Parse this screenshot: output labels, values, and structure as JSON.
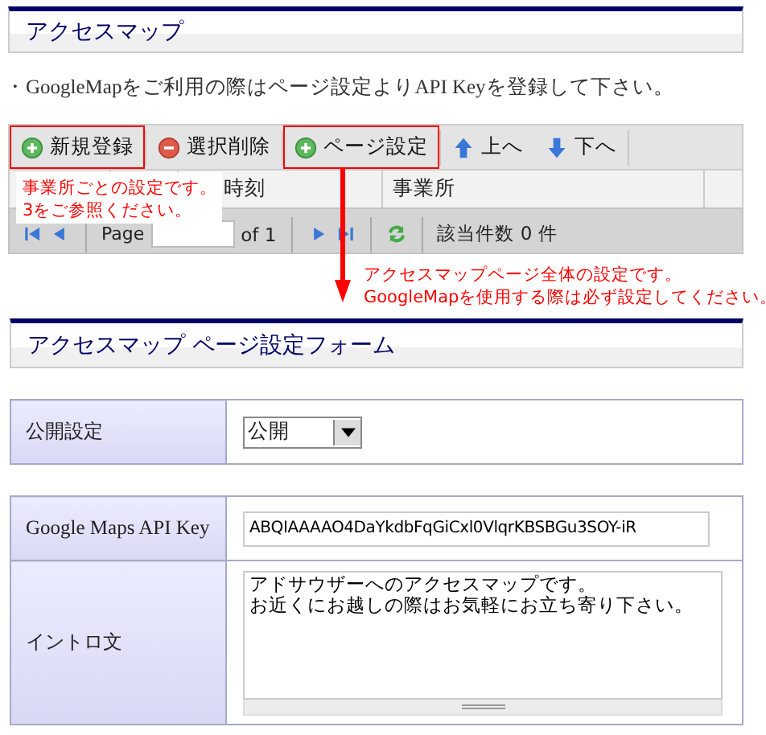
{
  "section_title": "アクセスマップ",
  "notice": "・GoogleMapをご利用の際はページ設定よりAPI Keyを登録して下さい。",
  "toolbar": [
    {
      "kind": "add",
      "label": "新規登録",
      "highlighted": true
    },
    {
      "kind": "delete",
      "label": "選択削除",
      "highlighted": false
    },
    {
      "kind": "add",
      "label": "ページ設定",
      "highlighted": true
    },
    {
      "kind": "up",
      "label": "上へ",
      "highlighted": false
    },
    {
      "kind": "down",
      "label": "下へ",
      "highlighted": false
    }
  ],
  "grid": {
    "columns": [
      "時刻",
      "事業所"
    ]
  },
  "pager": {
    "page_label": "Page",
    "of": "of 1",
    "count": "該当件数 0 件"
  },
  "callouts": [
    {
      "lines": [
        "事業所ごとの設定です。",
        "3をご参照ください。"
      ]
    },
    {
      "lines": [
        "アクセスマップページ全体の設定です。",
        "GoogleMapを使用する際は必ず設定してください。"
      ]
    }
  ],
  "form_title": "アクセスマップ ページ設定フォーム",
  "form_tables": [
    [
      {
        "kind": "select",
        "label": "公開設定",
        "value": "公開"
      }
    ],
    [
      {
        "kind": "text",
        "label": "Google Maps API Key",
        "value": "ABQIAAAAO4DaYkdbFqGiCxl0VlqrKBSBGu3SOY-iR"
      },
      {
        "kind": "textarea",
        "label": "イントロ文",
        "lines": [
          "アドサウザーへのアクセスマップです。",
          "お近くにお越しの際はお気軽にお立ち寄り下さい。"
        ]
      }
    ]
  ]
}
